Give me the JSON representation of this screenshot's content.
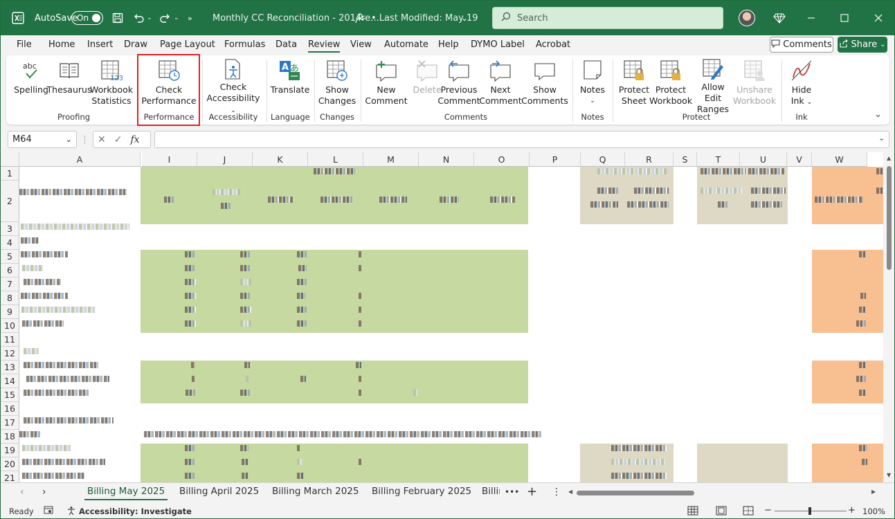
{
  "titlebar": {
    "autosave_label": "AutoSave",
    "autosave_state": "On",
    "doc_title": "Monthly CC Reconciliation - 2014re...",
    "last_modified": "• Last Modified: May 19",
    "search_placeholder": "Search"
  },
  "menu": {
    "items": [
      "File",
      "Home",
      "Insert",
      "Draw",
      "Page Layout",
      "Formulas",
      "Data",
      "Review",
      "View",
      "Automate",
      "Help",
      "DYMO Label",
      "Acrobat"
    ],
    "active": "Review",
    "comments_label": "Comments",
    "share_label": "Share"
  },
  "ribbon": {
    "buttons": {
      "spelling": "Spelling",
      "thesaurus": "Thesaurus",
      "workbook_stats_1": "Workbook",
      "workbook_stats_2": "Statistics",
      "check_perf_1": "Check",
      "check_perf_2": "Performance",
      "check_access_1": "Check",
      "check_access_2": "Accessibility",
      "translate": "Translate",
      "show_changes_1": "Show",
      "show_changes_2": "Changes",
      "new_comment_1": "New",
      "new_comment_2": "Comment",
      "delete": "Delete",
      "prev_comment_1": "Previous",
      "prev_comment_2": "Comment",
      "next_comment_1": "Next",
      "next_comment_2": "Comment",
      "show_comments_1": "Show",
      "show_comments_2": "Comments",
      "notes": "Notes",
      "protect_sheet_1": "Protect",
      "protect_sheet_2": "Sheet",
      "protect_wb_1": "Protect",
      "protect_wb_2": "Workbook",
      "allow_edit_1": "Allow Edit",
      "allow_edit_2": "Ranges",
      "unshare_1": "Unshare",
      "unshare_2": "Workbook",
      "hide_ink_1": "Hide",
      "hide_ink_2": "Ink"
    },
    "groups": {
      "proofing": "Proofing",
      "performance": "Performance",
      "accessibility": "Accessibility",
      "language": "Language",
      "changes": "Changes",
      "comments": "Comments",
      "notes": "Notes",
      "protect": "Protect",
      "ink": "Ink"
    }
  },
  "formula_bar": {
    "name_box": "M64",
    "fx": "fx",
    "formula": ""
  },
  "grid": {
    "columns": [
      "A",
      "I",
      "J",
      "K",
      "L",
      "M",
      "N",
      "O",
      "P",
      "Q",
      "R",
      "S",
      "T",
      "U",
      "V",
      "W"
    ],
    "rows": [
      "1",
      "2",
      "3",
      "4",
      "5",
      "6",
      "7",
      "8",
      "9",
      "10",
      "11",
      "12",
      "13",
      "14",
      "15",
      "16",
      "17",
      "18",
      "19",
      "20",
      "21"
    ]
  },
  "sheets": {
    "tabs": [
      "Billing May 2025",
      "Billing April 2025",
      "Billing March 2025",
      "Billing February 2025",
      "Billir"
    ],
    "active": "Billing May 2025",
    "more": "•••",
    "add": "+"
  },
  "status": {
    "ready": "Ready",
    "accessibility": "Accessibility: Investigate",
    "zoom": "100%",
    "zoom_minus": "−",
    "zoom_plus": "+"
  },
  "colors": {
    "brand": "#217346",
    "green_fill": "#c6d9a0",
    "tan_fill": "#ddd9c4",
    "orange_fill": "#f8bf90",
    "highlight": "#e0201f"
  }
}
